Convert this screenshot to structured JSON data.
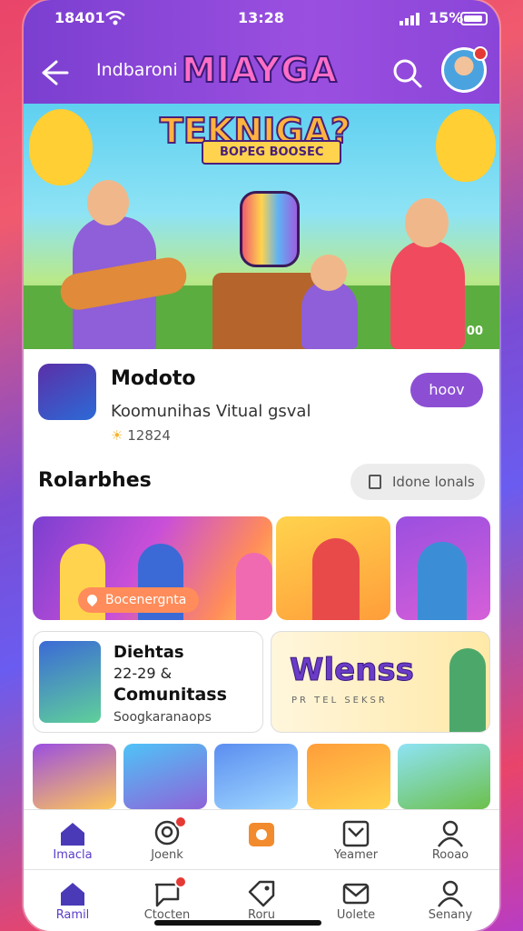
{
  "status_bar": {
    "time_left": "18401",
    "time_center": "13:28",
    "battery": "15%"
  },
  "header": {
    "back_label": "Indbaroni",
    "logo_line1": "MIAYGA",
    "avatar_alt": "user avatar"
  },
  "hero": {
    "title": "TEKNIGA?",
    "ribbon": "BOPEG BOOSEC",
    "counter": "00"
  },
  "app": {
    "name": "Modoto",
    "description": "Koomunihas Vitual gsval",
    "rating": "12824",
    "follow_button": "hoov"
  },
  "section": {
    "title": "Rolarbhes",
    "more_button": "Idone lonals"
  },
  "cards": {
    "featured_tag": "Bocenergnta",
    "community_title": "Diehtas",
    "community_sub": "22-29 &",
    "community_title2": "Comunitass",
    "community_tag": "Soogkaranaops",
    "promo_text": "Wlenss",
    "promo_sub": "PR TEL SEKSR"
  },
  "nav_top": [
    {
      "label": "Imacla",
      "icon": "home-icon",
      "active": true
    },
    {
      "label": "Joenk",
      "icon": "chat-icon",
      "active": false
    },
    {
      "label": "",
      "icon": "media-icon",
      "active": false
    },
    {
      "label": "Yeamer",
      "icon": "inbox-icon",
      "active": false
    },
    {
      "label": "Rooao",
      "icon": "profile-icon",
      "active": false
    }
  ],
  "nav_bottom": [
    {
      "label": "Ramil",
      "icon": "home-icon",
      "active": true
    },
    {
      "label": "Ctocten",
      "icon": "chat-icon",
      "active": false
    },
    {
      "label": "Roru",
      "icon": "tag-icon",
      "active": false
    },
    {
      "label": "Uolete",
      "icon": "mail-icon",
      "active": false
    },
    {
      "label": "Senany",
      "icon": "profile-icon",
      "active": false
    }
  ],
  "colors": {
    "accent": "#8c4fd4",
    "header": "#7b3fd0",
    "badge": "#e53935"
  }
}
